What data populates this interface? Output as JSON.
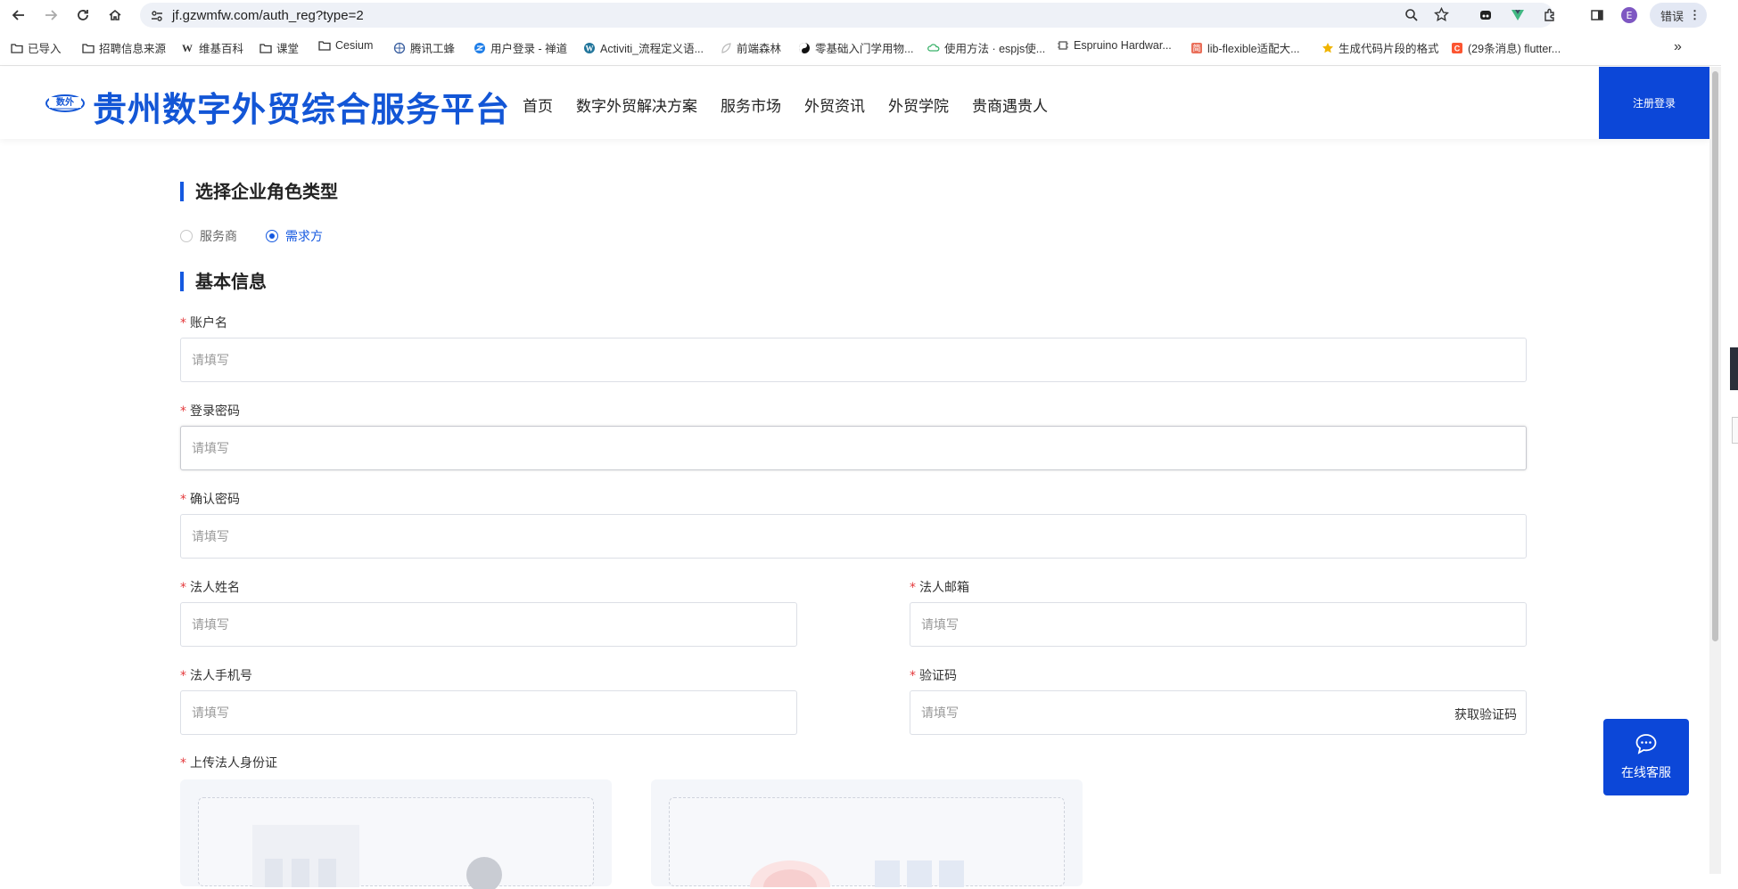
{
  "browser": {
    "url": "jf.gzwmfw.com/auth_reg?type=2",
    "profile_label": "错误",
    "avatar_letter": "E"
  },
  "bookmarks": [
    {
      "label": "已导入",
      "icon": "folder-icon"
    },
    {
      "label": "招聘信息来源",
      "icon": "folder-icon"
    },
    {
      "label": "维基百科",
      "icon": "wikipedia-icon"
    },
    {
      "label": "课堂",
      "icon": "folder-icon"
    },
    {
      "label": "Cesium",
      "icon": "folder-icon"
    },
    {
      "label": "腾讯工蜂",
      "icon": "globe-icon"
    },
    {
      "label": "用户登录 - 禅道",
      "icon": "zentao-icon"
    },
    {
      "label": "Activiti_流程定义语...",
      "icon": "wordpress-icon"
    },
    {
      "label": "前端森林",
      "icon": "leaf-icon"
    },
    {
      "label": "零基础入门学用物...",
      "icon": "yinyang-icon"
    },
    {
      "label": "使用方法 · espjs使...",
      "icon": "cloud-icon"
    },
    {
      "label": "Espruino Hardwar...",
      "icon": "chip-icon"
    },
    {
      "label": "lib-flexible适配大...",
      "icon": "jianshu-icon"
    },
    {
      "label": "生成代码片段的格式",
      "icon": "star-icon"
    },
    {
      "label": "(29条消息) flutter...",
      "icon": "csdn-icon"
    }
  ],
  "header": {
    "site_title": "贵州数字外贸综合服务平台",
    "nav": [
      "首页",
      "数字外贸解决方案",
      "服务市场",
      "外贸资讯",
      "外贸学院",
      "贵商遇贵人"
    ],
    "register_login": "注册登录"
  },
  "form": {
    "role_section_title": "选择企业角色类型",
    "roles": [
      {
        "label": "服务商",
        "selected": false
      },
      {
        "label": "需求方",
        "selected": true
      }
    ],
    "basic_section_title": "基本信息",
    "required_mark": "*",
    "fields": {
      "account": {
        "label": "账户名",
        "placeholder": "请填写"
      },
      "password": {
        "label": "登录密码",
        "placeholder": "请填写"
      },
      "confirm_password": {
        "label": "确认密码",
        "placeholder": "请填写"
      },
      "legal_name": {
        "label": "法人姓名",
        "placeholder": "请填写"
      },
      "legal_email": {
        "label": "法人邮箱",
        "placeholder": "请填写"
      },
      "legal_phone": {
        "label": "法人手机号",
        "placeholder": "请填写"
      },
      "verify_code": {
        "label": "验证码",
        "placeholder": "请填写",
        "action": "获取验证码"
      }
    },
    "upload_label": "上传法人身份证"
  },
  "float": {
    "online_service": "在线客服"
  },
  "colors": {
    "brand_blue": "#1356d6",
    "button_blue": "#0c47d8",
    "required_red": "#e4393c"
  }
}
